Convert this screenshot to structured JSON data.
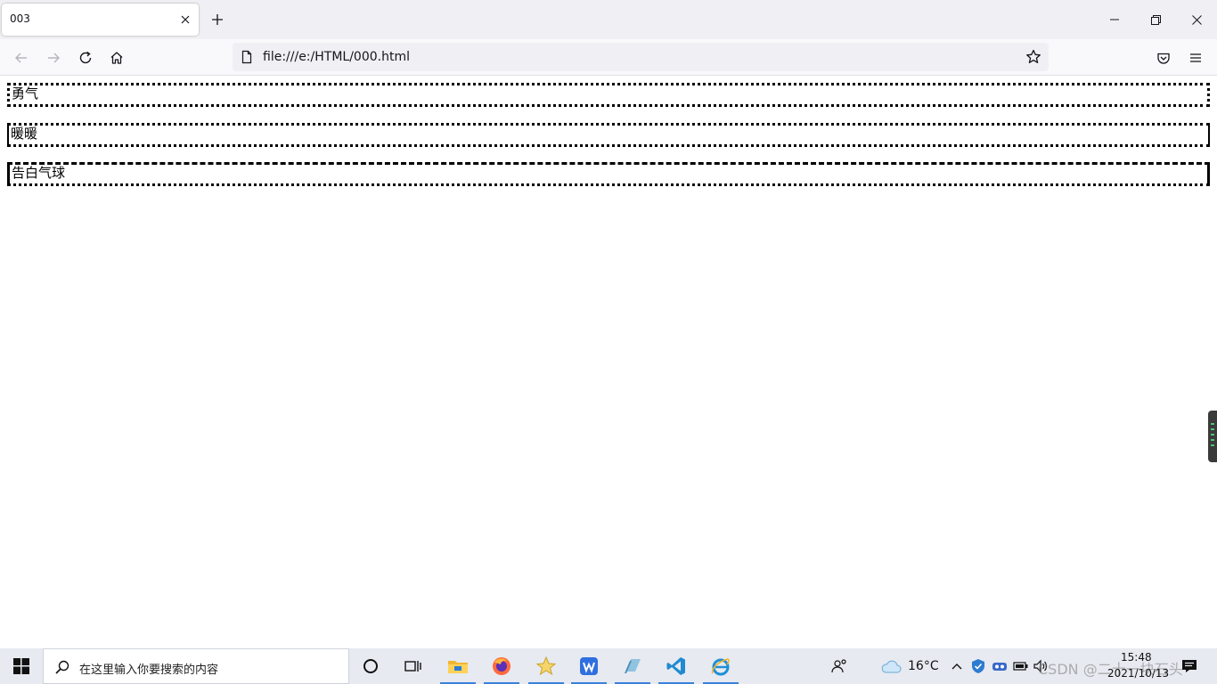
{
  "browser": {
    "tab": {
      "title": "003"
    },
    "url": "file:///e:/HTML/000.html",
    "icons": [
      "close-icon",
      "plus-icon",
      "minimize-icon",
      "restore-icon",
      "window-close-icon",
      "back-arrow-icon",
      "forward-arrow-icon",
      "reload-icon",
      "home-icon",
      "page-icon",
      "star-icon",
      "pocket-icon",
      "menu-icon"
    ]
  },
  "content": {
    "boxes": [
      {
        "text": "勇气"
      },
      {
        "text": "暖暖"
      },
      {
        "text": "告白气球"
      }
    ]
  },
  "taskbar": {
    "search_placeholder": "在这里输入你要搜索的内容",
    "weather": "16°C",
    "time": "15:48",
    "date": "2021/10/13",
    "watermark": "CSDN @二十一块石头",
    "accent": "#3b82d9"
  }
}
